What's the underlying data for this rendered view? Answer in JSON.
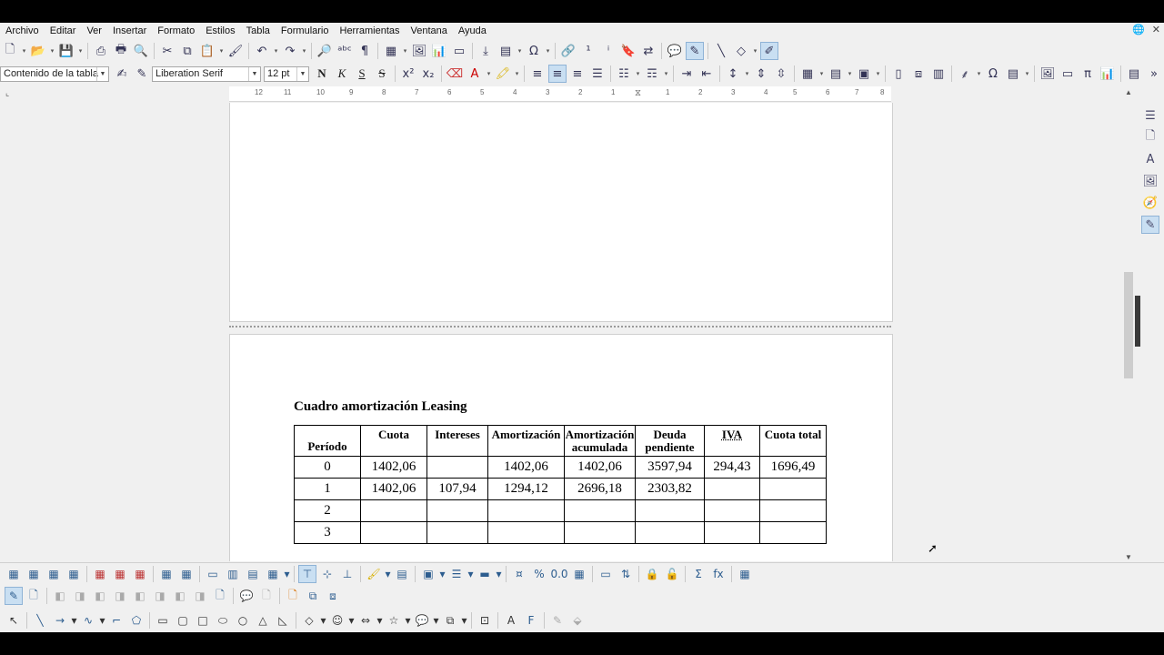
{
  "menubar": {
    "items": [
      "Archivo",
      "Editar",
      "Ver",
      "Insertar",
      "Formato",
      "Estilos",
      "Tabla",
      "Formulario",
      "Herramientas",
      "Ventana",
      "Ayuda"
    ]
  },
  "formatting": {
    "paragraph_style": "Contenido de la tabla",
    "font_name": "Liberation Serif",
    "font_size": "12 pt",
    "bold_label": "N",
    "italic_label": "K",
    "underline_label": "S",
    "strike_label": "S"
  },
  "ruler": {
    "ticks": [
      "12",
      "11",
      "10",
      "9",
      "8",
      "7",
      "6",
      "5",
      "4",
      "3",
      "2",
      "1",
      "1",
      "2",
      "3",
      "4",
      "5",
      "6",
      "7",
      "8"
    ]
  },
  "document": {
    "title": "Cuadro amortización Leasing",
    "table": {
      "headers": [
        "Período",
        "Cuota",
        "Intereses",
        "Amortización",
        "Amortización\nacumulada",
        "Deuda\npendiente",
        "IVA",
        "Cuota total"
      ],
      "rows": [
        [
          "0",
          "1402,06",
          "",
          "1402,06",
          "1402,06",
          "3597,94",
          "294,43",
          "1696,49"
        ],
        [
          "1",
          "1402,06",
          "107,94",
          "1294,12",
          "2696,18",
          "2303,82",
          "",
          ""
        ],
        [
          "2",
          "",
          "",
          "",
          "",
          "",
          "",
          ""
        ],
        [
          "3",
          "",
          "",
          "",
          "",
          "",
          "",
          ""
        ]
      ]
    }
  }
}
